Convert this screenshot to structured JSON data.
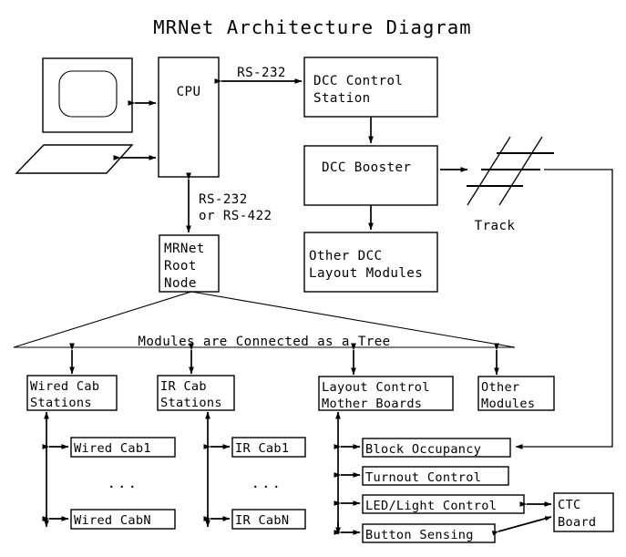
{
  "diagram": {
    "title": "MRNet Architecture Diagram",
    "background_color": "#ffffff",
    "line_color": "#000000"
  },
  "nodes": {
    "monitor": {
      "name": "monitor",
      "label": ""
    },
    "keyboard": {
      "name": "keyboard",
      "label": ""
    },
    "cpu": {
      "label": "CPU"
    },
    "dcc_control_station": {
      "line1": "DCC Control",
      "line2": "Station"
    },
    "dcc_booster": {
      "label": "DCC Booster"
    },
    "other_dcc_layout_modules": {
      "line1": "Other DCC",
      "line2": "Layout Modules"
    },
    "track": {
      "label": "Track"
    },
    "mrnet_root_node": {
      "line1": "MRNet",
      "line2": "Root",
      "line3": "Node"
    },
    "tree_caption": {
      "label": "Modules are Connected as a Tree"
    },
    "wired_cab_stations": {
      "line1": "Wired Cab",
      "line2": "Stations"
    },
    "ir_cab_stations": {
      "line1": "IR Cab",
      "line2": "Stations"
    },
    "layout_control_mother_boards": {
      "line1": "Layout Control",
      "line2": "Mother Boards"
    },
    "other_modules": {
      "line1": "Other",
      "line2": "Modules"
    },
    "wired_cab1": {
      "label": "Wired Cab1"
    },
    "wired_cabn": {
      "label": "Wired CabN"
    },
    "wired_ellipsis": {
      "label": "..."
    },
    "ir_cab1": {
      "label": "IR Cab1"
    },
    "ir_cabn": {
      "label": "IR CabN"
    },
    "ir_ellipsis": {
      "label": "..."
    },
    "block_occupancy": {
      "label": "Block Occupancy"
    },
    "turnout_control": {
      "label": "Turnout Control"
    },
    "led_light_control": {
      "label": "LED/Light Control"
    },
    "button_sensing": {
      "label": "Button Sensing"
    },
    "ctc_board": {
      "line1": "CTC",
      "line2": "Board"
    }
  },
  "edge_labels": {
    "cpu_to_dcc": "RS-232",
    "cpu_to_mrnet_line1": "RS-232",
    "cpu_to_mrnet_line2": "or RS-422"
  }
}
